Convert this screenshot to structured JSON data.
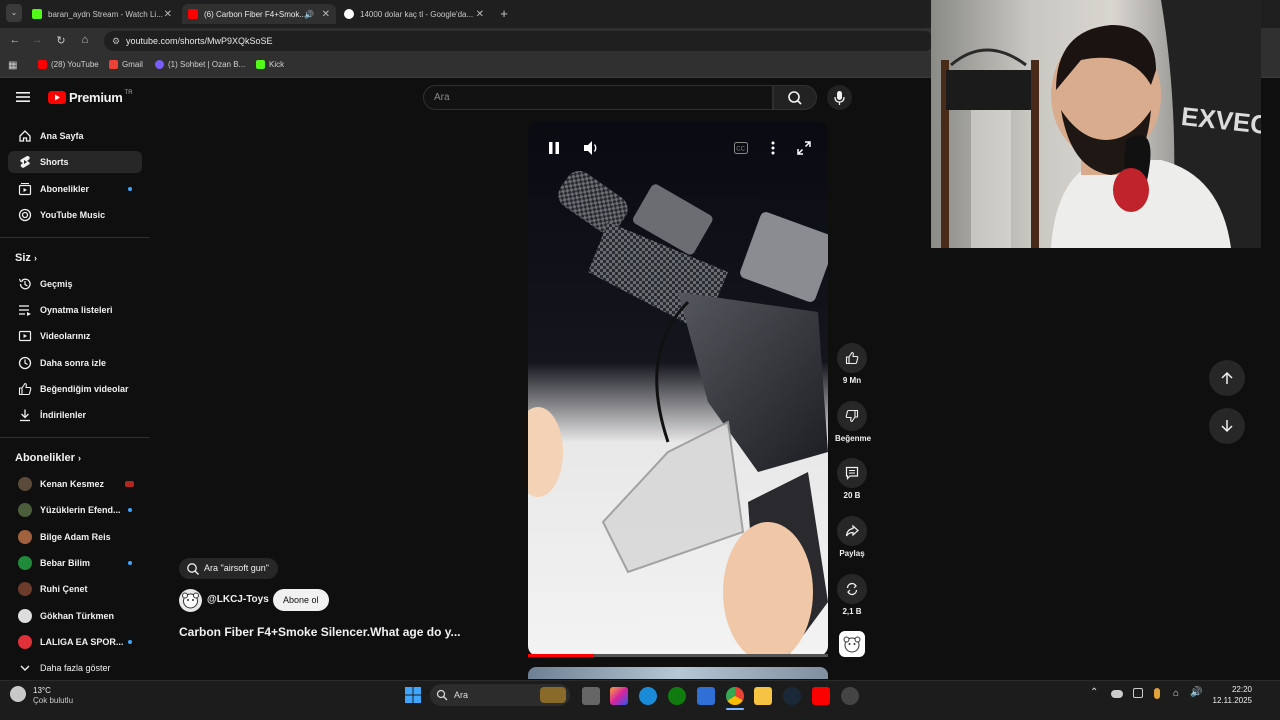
{
  "browser": {
    "tabs": [
      {
        "label": "baran_aydn Stream - Watch Li...",
        "active": false
      },
      {
        "label": "(6) Carbon Fiber F4+Smok...",
        "active": true
      },
      {
        "label": "14000 dolar kaç tl - Google'da...",
        "active": false
      }
    ],
    "url": "youtube.com/shorts/MwP9XQkSoSE",
    "bookmarks": [
      "(28) YouTube",
      "Gmail",
      "(1) Sohbet | Ozan B...",
      "Kick"
    ]
  },
  "header": {
    "logo_text": "Premium",
    "logo_region": "TR",
    "search_placeholder": "Ara"
  },
  "sidebar": {
    "main": [
      {
        "label": "Ana Sayfa",
        "icon": "home-icon"
      },
      {
        "label": "Shorts",
        "icon": "shorts-icon",
        "active": true
      },
      {
        "label": "Abonelikler",
        "icon": "subscriptions-icon",
        "dot": true
      },
      {
        "label": "YouTube Music",
        "icon": "music-icon"
      }
    ],
    "you_title": "Siz",
    "you": [
      {
        "label": "Geçmiş",
        "icon": "history-icon"
      },
      {
        "label": "Oynatma listeleri",
        "icon": "playlist-icon"
      },
      {
        "label": "Videolarınız",
        "icon": "your-videos-icon"
      },
      {
        "label": "Daha sonra izle",
        "icon": "watch-later-icon"
      },
      {
        "label": "Beğendiğim videolar",
        "icon": "liked-icon"
      },
      {
        "label": "İndirilenler",
        "icon": "download-icon"
      }
    ],
    "subs_title": "Abonelikler",
    "subs": [
      {
        "label": "Kenan Kesmez",
        "color": "#5a4a3a",
        "live": true
      },
      {
        "label": "Yüzüklerin Efend...",
        "color": "#4b5d3a",
        "dot": true
      },
      {
        "label": "Bilge Adam Reis",
        "color": "#a0623e"
      },
      {
        "label": "Bebar Bilim",
        "color": "#1f8a3a",
        "dot": true
      },
      {
        "label": "Ruhi Çenet",
        "color": "#6b3b2b"
      },
      {
        "label": "Gökhan Türkmen",
        "color": "#dddddd"
      },
      {
        "label": "LALIGA EA SPOR...",
        "color": "#e0303a",
        "dot": true
      }
    ],
    "show_more": "Daha fazla göster"
  },
  "video": {
    "search_chip": "Ara \"airsoft gun\"",
    "channel": "@LKCJ-Toys",
    "subscribe": "Abone ol",
    "title": "Carbon Fiber F4+Smoke Silencer.What age do y...",
    "progress": 0.22
  },
  "actions": {
    "likes": "9 Mn",
    "dislike": "Beğenme",
    "comments": "20 B",
    "share": "Paylaş",
    "remix": "2,1 B"
  },
  "webcam": {
    "jersey_text": "EXVEGA"
  },
  "taskbar": {
    "weather_temp": "13°C",
    "weather_desc": "Çok bulutlu",
    "search": "Ara",
    "time": "22:20",
    "date": "12.11.2025"
  },
  "colors": {
    "accent": "#ff0000",
    "sidebar_active": "#272727",
    "dot": "#3ea6ff"
  }
}
